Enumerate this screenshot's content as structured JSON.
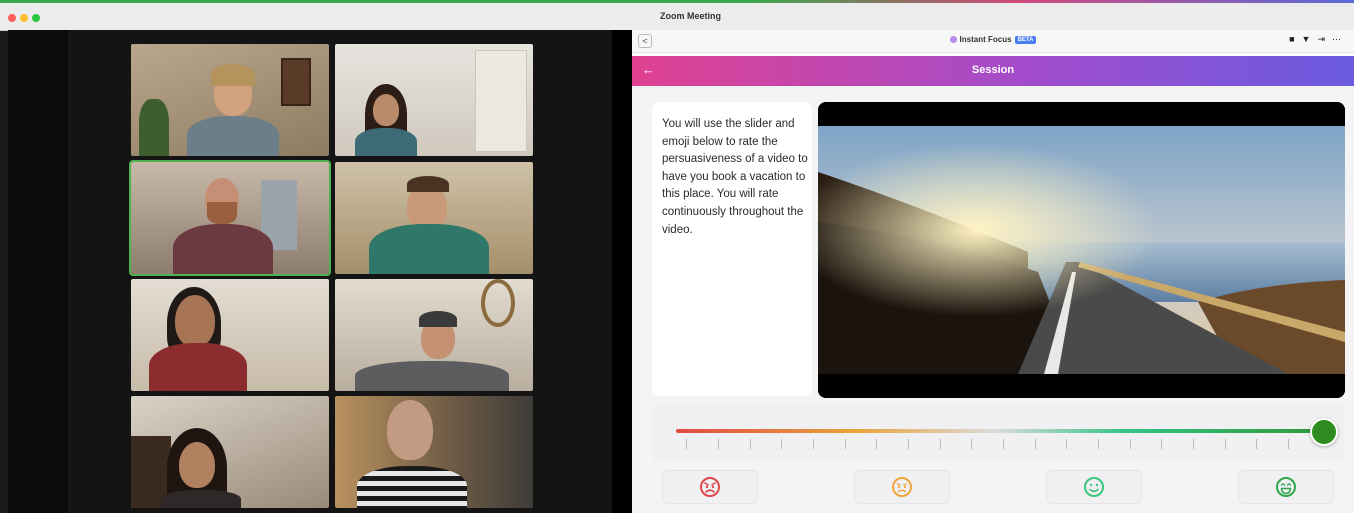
{
  "window": {
    "title": "Zoom Meeting"
  },
  "app": {
    "brand": "Instant Focus",
    "badge": "BETA",
    "back_small": "<",
    "toolbar_icons": [
      "video-icon",
      "filter-icon",
      "collapse-icon",
      "more-icon"
    ]
  },
  "session": {
    "back_arrow": "←",
    "title": "Session"
  },
  "instructions": "You will use the slider and emoji below to rate the persuasiveness of a video to have you book a vacation to this place. You will rate continuously throughout the video.",
  "rating": {
    "slider_value": 1.0,
    "emojis": [
      {
        "name": "angry-face-icon",
        "color": "#e0464a"
      },
      {
        "name": "sad-face-icon",
        "color": "#f0a43a"
      },
      {
        "name": "smile-face-icon",
        "color": "#3cc57e"
      },
      {
        "name": "grin-face-icon",
        "color": "#2ea84b"
      }
    ]
  },
  "colors": {
    "accent_pink": "#e04191",
    "accent_purple": "#6a5be0",
    "active_speaker": "#4fb34f"
  }
}
